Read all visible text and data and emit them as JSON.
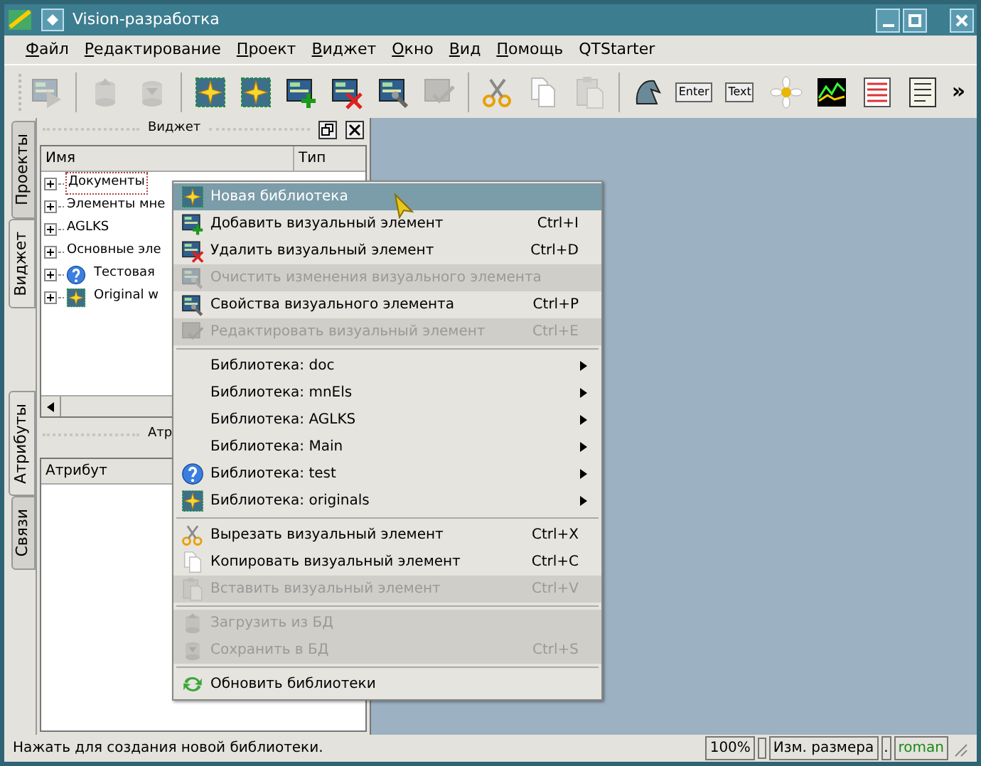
{
  "window": {
    "title": "Vision-разработка"
  },
  "menubar": [
    {
      "label": "Файл",
      "mnemonic": true
    },
    {
      "label": "Редактирование",
      "mnemonic": true
    },
    {
      "label": "Проект",
      "mnemonic": true
    },
    {
      "label": "Виджет",
      "mnemonic": true
    },
    {
      "label": "Окно",
      "mnemonic": true
    },
    {
      "label": "Вид",
      "mnemonic": true
    },
    {
      "label": "Помощь",
      "mnemonic": true
    },
    {
      "label": "QTStarter",
      "mnemonic": false
    }
  ],
  "toolbar": [
    {
      "kind": "button",
      "disabled": true
    },
    {
      "kind": "separator"
    },
    {
      "kind": "button",
      "disabled": true
    },
    {
      "kind": "button",
      "disabled": true
    },
    {
      "kind": "separator"
    },
    {
      "kind": "button",
      "disabled": false
    },
    {
      "kind": "button",
      "disabled": false
    },
    {
      "kind": "button",
      "disabled": false
    },
    {
      "kind": "button",
      "disabled": false
    },
    {
      "kind": "button",
      "disabled": false
    },
    {
      "kind": "button",
      "disabled": true
    },
    {
      "kind": "separator"
    },
    {
      "kind": "button",
      "disabled": false
    },
    {
      "kind": "button",
      "disabled": false
    },
    {
      "kind": "button",
      "disabled": true
    },
    {
      "kind": "separator"
    },
    {
      "kind": "button",
      "disabled": false
    },
    {
      "kind": "button",
      "label": "Enter",
      "disabled": false
    },
    {
      "kind": "button",
      "label": "Text",
      "disabled": false
    },
    {
      "kind": "button",
      "disabled": false
    },
    {
      "kind": "button",
      "disabled": false
    },
    {
      "kind": "button",
      "disabled": false
    },
    {
      "kind": "button",
      "disabled": false
    },
    {
      "kind": "more",
      "label": "»"
    }
  ],
  "side_tabs_top": [
    {
      "label": "Проекты",
      "selected": false
    },
    {
      "label": "Виджет",
      "selected": true
    }
  ],
  "side_tabs_bottom": [
    {
      "label": "Атрибуты",
      "selected": true
    },
    {
      "label": "Связи",
      "selected": false
    }
  ],
  "widget_dock": {
    "title": "Виджет",
    "columns": [
      "Имя",
      "Тип"
    ],
    "rows": [
      {
        "name": "Документы",
        "selected": true
      },
      {
        "name": "Элементы мне",
        "selected": false
      },
      {
        "name": "AGLKS",
        "selected": false
      },
      {
        "name": "Основные эле",
        "selected": false
      },
      {
        "name": "Тестовая",
        "selected": false
      },
      {
        "name": "Original w",
        "selected": false
      }
    ]
  },
  "attributes_dock": {
    "title": "Атр",
    "columns": [
      "Атрибут"
    ]
  },
  "context_menu": [
    {
      "kind": "item",
      "label": "Новая библиотека",
      "selected": true,
      "disabled": false
    },
    {
      "kind": "item",
      "label": "Добавить визуальный элемент",
      "shortcut": "Ctrl+I",
      "selected": false,
      "disabled": false
    },
    {
      "kind": "item",
      "label": "Удалить визуальный элемент",
      "shortcut": "Ctrl+D",
      "selected": false,
      "disabled": false
    },
    {
      "kind": "item",
      "label": "Очистить изменения визуального элемента",
      "selected": false,
      "disabled": true
    },
    {
      "kind": "item",
      "label": "Свойства визуального элемента",
      "shortcut": "Ctrl+P",
      "selected": false,
      "disabled": false
    },
    {
      "kind": "item",
      "label": "Редактировать визуальный элемент",
      "shortcut": "Ctrl+E",
      "selected": false,
      "disabled": true
    },
    {
      "kind": "separator"
    },
    {
      "kind": "submenu",
      "label": "Библиотека: doc",
      "selected": false,
      "disabled": false
    },
    {
      "kind": "submenu",
      "label": "Библиотека: mnEls",
      "selected": false,
      "disabled": false
    },
    {
      "kind": "submenu",
      "label": "Библиотека: AGLKS",
      "selected": false,
      "disabled": false
    },
    {
      "kind": "submenu",
      "label": "Библиотека: Main",
      "selected": false,
      "disabled": false
    },
    {
      "kind": "submenu",
      "label": "Библиотека: test",
      "selected": false,
      "disabled": false
    },
    {
      "kind": "submenu",
      "label": "Библиотека: originals",
      "selected": false,
      "disabled": false
    },
    {
      "kind": "separator"
    },
    {
      "kind": "item",
      "label": "Вырезать визуальный элемент",
      "shortcut": "Ctrl+X",
      "selected": false,
      "disabled": false
    },
    {
      "kind": "item",
      "label": "Копировать визуальный элемент",
      "shortcut": "Ctrl+C",
      "selected": false,
      "disabled": false
    },
    {
      "kind": "item",
      "label": "Вставить визуальный элемент",
      "shortcut": "Ctrl+V",
      "selected": false,
      "disabled": true
    },
    {
      "kind": "separator"
    },
    {
      "kind": "item",
      "label": "Загрузить из БД",
      "selected": false,
      "disabled": true
    },
    {
      "kind": "item",
      "label": "Сохранить в БД",
      "shortcut": "Ctrl+S",
      "selected": false,
      "disabled": true
    },
    {
      "kind": "separator"
    },
    {
      "kind": "item",
      "label": "Обновить библиотеки",
      "selected": false,
      "disabled": false
    }
  ],
  "status_bar": {
    "message": "Нажать для создания новой библиотеки.",
    "zoom": "100%",
    "mode": "Изм. размера",
    "dot": ".",
    "user": "roman"
  }
}
